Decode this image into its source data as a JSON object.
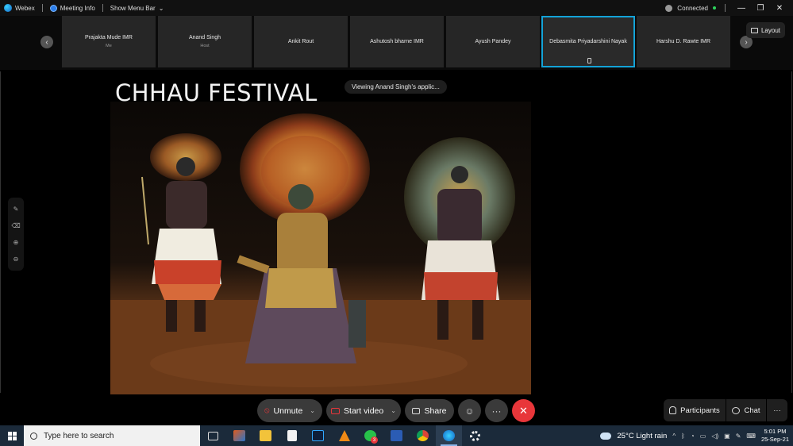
{
  "titlebar": {
    "app_name": "Webex",
    "meeting_info": "Meeting Info",
    "show_menu_bar": "Show Menu Bar",
    "chevron": "⌄",
    "status": "Connected",
    "controls": {
      "minimize": "—",
      "restore": "❐",
      "close": "✕"
    }
  },
  "participants": [
    {
      "name": "Prajakta Mude IMR",
      "sub": "Me"
    },
    {
      "name": "Anand Singh",
      "sub": "Host"
    },
    {
      "name": "Ankit Rout",
      "sub": ""
    },
    {
      "name": "Ashutosh bharne IMR",
      "sub": ""
    },
    {
      "name": "Ayush Pandey",
      "sub": ""
    },
    {
      "name": "Debasmita Priyadarshini Nayak",
      "sub": "",
      "active": true
    },
    {
      "name": "Harshu D. Rawte IMR",
      "sub": ""
    }
  ],
  "strip_nav": {
    "prev": "‹",
    "next": "›"
  },
  "layout_button": "Layout",
  "share": {
    "slide_title": "CHHAU FESTIVAL",
    "viewing_label": "Viewing Anand Singh's applic..."
  },
  "side_tools": [
    "✎",
    "⌫",
    "⊕",
    "⊖"
  ],
  "controls": {
    "unmute": "Unmute",
    "start_video": "Start video",
    "share": "Share",
    "reactions": "☺",
    "more": "···",
    "end": "✕",
    "participants": "Participants",
    "chat": "Chat",
    "more_right": "···",
    "caret": "⌄"
  },
  "taskbar": {
    "search_placeholder": "Type here to search",
    "whatsapp_badge": "3",
    "weather": "25°C  Light rain",
    "time": "5:01 PM",
    "date": "25-Sep-21",
    "tray_arrow": "^"
  },
  "colors": {
    "active_tile_border": "#13a3d8",
    "end_button": "#e8363a",
    "connected_dot": "#2dd35c",
    "taskbar": "#1b2a3a"
  },
  "icons": [
    "webex-logo-icon",
    "info-icon",
    "connected-icon",
    "layout-icon",
    "mic-muted-icon",
    "camera-off-icon",
    "share-icon",
    "reaction-icon",
    "people-icon",
    "chat-icon",
    "windows-icon",
    "search-icon"
  ]
}
